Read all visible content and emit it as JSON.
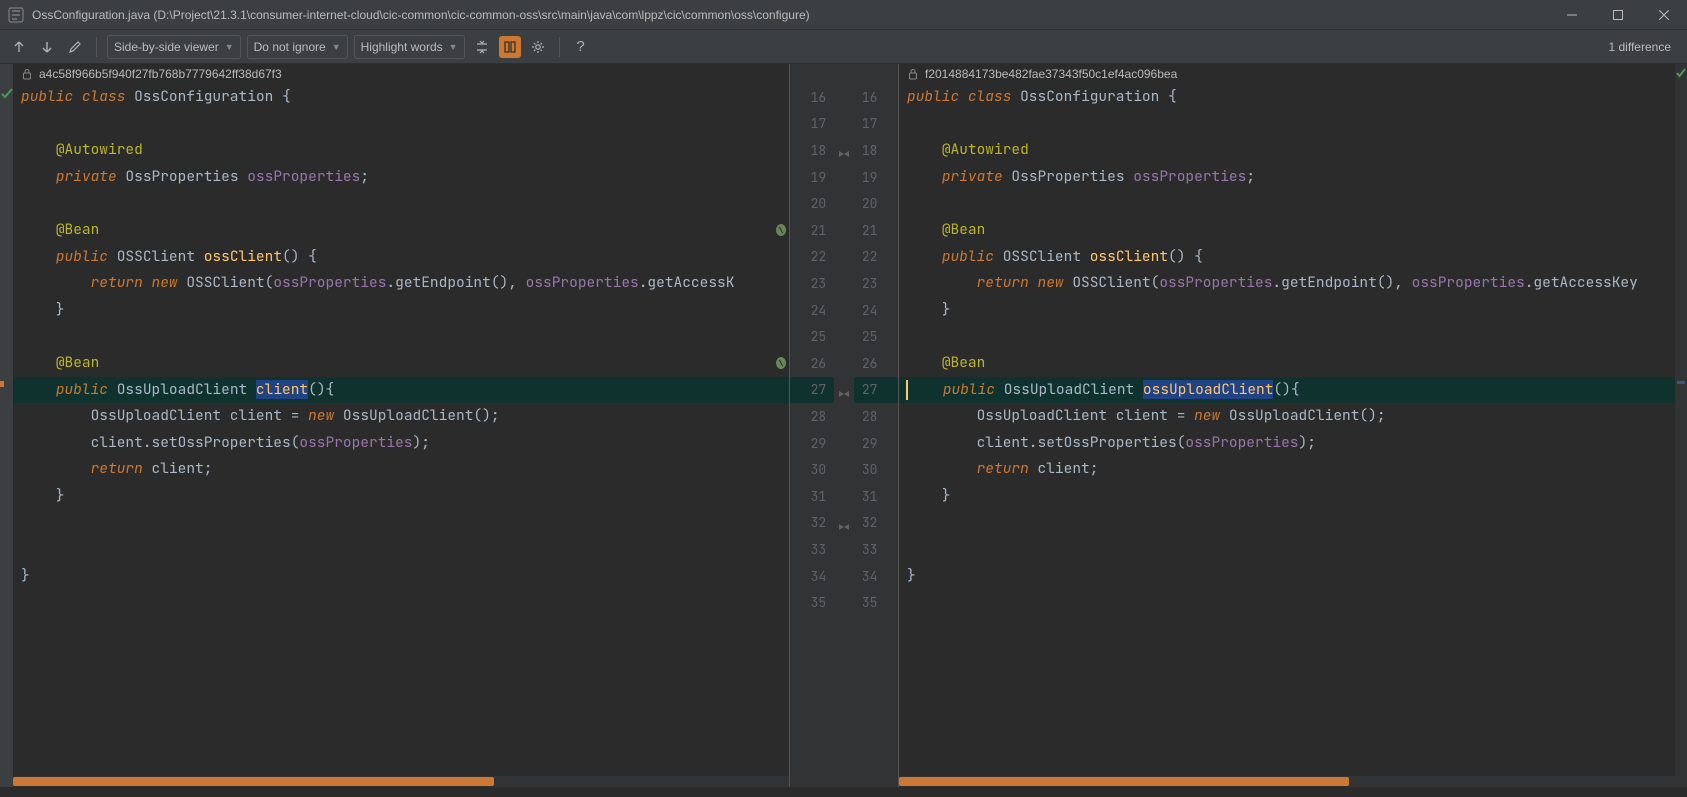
{
  "title": "OssConfiguration.java (D:\\Project\\21.3.1\\consumer-internet-cloud\\cic-common\\cic-common-oss\\src\\main\\java\\com\\lppz\\cic\\common\\oss\\configure)",
  "toolbar": {
    "viewer_mode": "Side-by-side viewer",
    "ignore_mode": "Do not ignore",
    "highlight_mode": "Highlight words",
    "diff_count": "1 difference"
  },
  "left": {
    "revision": "a4c58f966b5f940f27fb768b7779642ff38d67f3",
    "line_start": 16,
    "lines": [
      {
        "n": 16,
        "tokens": [
          {
            "t": "public ",
            "c": "kw"
          },
          {
            "t": "class ",
            "c": "kw"
          },
          {
            "t": "OssConfiguration ",
            "c": "fg"
          },
          {
            "t": "{",
            "c": "fg"
          }
        ]
      },
      {
        "n": 17,
        "tokens": []
      },
      {
        "n": 18,
        "tokens": [
          {
            "t": "    ",
            "c": "fg"
          },
          {
            "t": "@Autowired",
            "c": "anno"
          }
        ]
      },
      {
        "n": 19,
        "tokens": [
          {
            "t": "    ",
            "c": "fg"
          },
          {
            "t": "private ",
            "c": "kw"
          },
          {
            "t": "OssProperties ",
            "c": "fg"
          },
          {
            "t": "ossProperties",
            "c": "field"
          },
          {
            "t": ";",
            "c": "fg"
          }
        ]
      },
      {
        "n": 20,
        "tokens": []
      },
      {
        "n": 21,
        "tokens": [
          {
            "t": "    ",
            "c": "fg"
          },
          {
            "t": "@Bean",
            "c": "anno"
          }
        ],
        "bean": true
      },
      {
        "n": 22,
        "tokens": [
          {
            "t": "    ",
            "c": "fg"
          },
          {
            "t": "public ",
            "c": "kw"
          },
          {
            "t": "OSSClient ",
            "c": "fg"
          },
          {
            "t": "ossClient",
            "c": "method"
          },
          {
            "t": "() {",
            "c": "fg"
          }
        ]
      },
      {
        "n": 23,
        "tokens": [
          {
            "t": "        ",
            "c": "fg"
          },
          {
            "t": "return new ",
            "c": "kw"
          },
          {
            "t": "OSSClient(",
            "c": "fg"
          },
          {
            "t": "ossProperties",
            "c": "field"
          },
          {
            "t": ".getEndpoint(), ",
            "c": "fg"
          },
          {
            "t": "ossProperties",
            "c": "field"
          },
          {
            "t": ".getAccessK",
            "c": "fg"
          }
        ]
      },
      {
        "n": 24,
        "tokens": [
          {
            "t": "    }",
            "c": "fg"
          }
        ]
      },
      {
        "n": 25,
        "tokens": []
      },
      {
        "n": 26,
        "tokens": [
          {
            "t": "    ",
            "c": "fg"
          },
          {
            "t": "@Bean",
            "c": "anno"
          }
        ],
        "bean": true
      },
      {
        "n": 27,
        "hl": true,
        "tokens": [
          {
            "t": "    ",
            "c": "fg"
          },
          {
            "t": "public ",
            "c": "kw"
          },
          {
            "t": "OssUploadClient ",
            "c": "fg"
          },
          {
            "t": "client",
            "c": "method",
            "hl": true
          },
          {
            "t": "(){",
            "c": "fg"
          }
        ]
      },
      {
        "n": 28,
        "tokens": [
          {
            "t": "        OssUploadClient client = ",
            "c": "fg"
          },
          {
            "t": "new ",
            "c": "kw"
          },
          {
            "t": "OssUploadClient();",
            "c": "fg"
          }
        ]
      },
      {
        "n": 29,
        "tokens": [
          {
            "t": "        client.setOssProperties(",
            "c": "fg"
          },
          {
            "t": "ossProperties",
            "c": "field"
          },
          {
            "t": ");",
            "c": "fg"
          }
        ]
      },
      {
        "n": 30,
        "tokens": [
          {
            "t": "        ",
            "c": "fg"
          },
          {
            "t": "return ",
            "c": "kw"
          },
          {
            "t": "client;",
            "c": "fg"
          }
        ]
      },
      {
        "n": 31,
        "tokens": [
          {
            "t": "    }",
            "c": "fg"
          }
        ]
      },
      {
        "n": 32,
        "tokens": []
      },
      {
        "n": 33,
        "tokens": []
      },
      {
        "n": 34,
        "tokens": [
          {
            "t": "}",
            "c": "fg"
          }
        ]
      },
      {
        "n": 35,
        "tokens": []
      }
    ]
  },
  "right": {
    "revision": "f2014884173be482fae37343f50c1ef4ac096bea",
    "line_start": 16,
    "lines": [
      {
        "n": 16,
        "tokens": [
          {
            "t": "public ",
            "c": "kw"
          },
          {
            "t": "class ",
            "c": "kw"
          },
          {
            "t": "OssConfiguration ",
            "c": "fg"
          },
          {
            "t": "{",
            "c": "fg"
          }
        ]
      },
      {
        "n": 17,
        "tokens": []
      },
      {
        "n": 18,
        "tokens": [
          {
            "t": "    ",
            "c": "fg"
          },
          {
            "t": "@Autowired",
            "c": "anno"
          }
        ]
      },
      {
        "n": 19,
        "tokens": [
          {
            "t": "    ",
            "c": "fg"
          },
          {
            "t": "private ",
            "c": "kw"
          },
          {
            "t": "OssProperties ",
            "c": "fg"
          },
          {
            "t": "ossProperties",
            "c": "field"
          },
          {
            "t": ";",
            "c": "fg"
          }
        ]
      },
      {
        "n": 20,
        "tokens": []
      },
      {
        "n": 21,
        "tokens": [
          {
            "t": "    ",
            "c": "fg"
          },
          {
            "t": "@Bean",
            "c": "anno"
          }
        ],
        "bean": true
      },
      {
        "n": 22,
        "tokens": [
          {
            "t": "    ",
            "c": "fg"
          },
          {
            "t": "public ",
            "c": "kw"
          },
          {
            "t": "OSSClient ",
            "c": "fg"
          },
          {
            "t": "ossClient",
            "c": "method"
          },
          {
            "t": "() {",
            "c": "fg"
          }
        ]
      },
      {
        "n": 23,
        "tokens": [
          {
            "t": "        ",
            "c": "fg"
          },
          {
            "t": "return new ",
            "c": "kw"
          },
          {
            "t": "OSSClient(",
            "c": "fg"
          },
          {
            "t": "ossProperties",
            "c": "field"
          },
          {
            "t": ".getEndpoint(), ",
            "c": "fg"
          },
          {
            "t": "ossProperties",
            "c": "field"
          },
          {
            "t": ".getAccessKey",
            "c": "fg"
          }
        ]
      },
      {
        "n": 24,
        "tokens": [
          {
            "t": "    }",
            "c": "fg"
          }
        ]
      },
      {
        "n": 25,
        "tokens": []
      },
      {
        "n": 26,
        "tokens": [
          {
            "t": "    ",
            "c": "fg"
          },
          {
            "t": "@Bean",
            "c": "anno"
          }
        ],
        "bean": true
      },
      {
        "n": 27,
        "hl": true,
        "caret": true,
        "tokens": [
          {
            "t": "    ",
            "c": "fg"
          },
          {
            "t": "public ",
            "c": "kw"
          },
          {
            "t": "OssUploadClient ",
            "c": "fg"
          },
          {
            "t": "ossUploadClient",
            "c": "method",
            "hl": true
          },
          {
            "t": "(){",
            "c": "fg"
          }
        ]
      },
      {
        "n": 28,
        "tokens": [
          {
            "t": "        OssUploadClient client = ",
            "c": "fg"
          },
          {
            "t": "new ",
            "c": "kw"
          },
          {
            "t": "OssUploadClient();",
            "c": "fg"
          }
        ]
      },
      {
        "n": 29,
        "tokens": [
          {
            "t": "        client.setOssProperties(",
            "c": "fg"
          },
          {
            "t": "ossProperties",
            "c": "field"
          },
          {
            "t": ");",
            "c": "fg"
          }
        ]
      },
      {
        "n": 30,
        "tokens": [
          {
            "t": "        ",
            "c": "fg"
          },
          {
            "t": "return ",
            "c": "kw"
          },
          {
            "t": "client;",
            "c": "fg"
          }
        ]
      },
      {
        "n": 31,
        "tokens": [
          {
            "t": "    }",
            "c": "fg"
          }
        ]
      },
      {
        "n": 32,
        "tokens": []
      },
      {
        "n": 33,
        "tokens": []
      },
      {
        "n": 34,
        "tokens": [
          {
            "t": "}",
            "c": "fg"
          }
        ]
      },
      {
        "n": 35,
        "tokens": []
      }
    ]
  }
}
